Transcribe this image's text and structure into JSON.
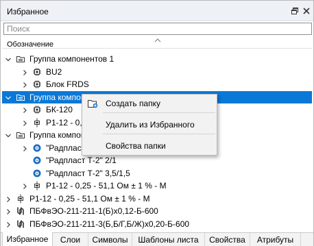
{
  "panel": {
    "title": "Избранное",
    "float_icon": "restore-window-icon",
    "close_icon": "close-icon"
  },
  "search": {
    "placeholder": "Поиск",
    "value": ""
  },
  "column": {
    "header": "Обозначение",
    "sort": "ascending"
  },
  "tree": [
    {
      "label": "Группа компонентов 1",
      "icon": "folder-icon",
      "chevron": "expanded",
      "indent": 0
    },
    {
      "label": "BU2",
      "icon": "chip-icon",
      "chevron": "collapsed",
      "indent": 1
    },
    {
      "label": "Блок FRDS",
      "icon": "chip-icon",
      "chevron": "collapsed",
      "indent": 1
    },
    {
      "label": "Группа компонентов 2",
      "icon": "folder-icon",
      "chevron": "expanded",
      "indent": 0,
      "selected": true
    },
    {
      "label": "БК-120",
      "icon": "chip-icon",
      "chevron": "collapsed",
      "indent": 1
    },
    {
      "label": "Р1-12 - 0,25 - 51,1 Ом ± 1 % - М",
      "icon": "resistor-icon",
      "chevron": "collapsed",
      "indent": 1
    },
    {
      "label": "Группа компонентов 3",
      "icon": "folder-icon",
      "chevron": "expanded",
      "indent": 0
    },
    {
      "label": "\"Радпласт Т-2\" 1/1",
      "icon": "cable-reel-icon",
      "chevron": "collapsed",
      "indent": 1
    },
    {
      "label": "\"Радпласт Т-2\" 2/1",
      "icon": "cable-reel-icon",
      "chevron": "none",
      "indent": 1
    },
    {
      "label": "\"Радпласт Т-2\" 3,5/1,5",
      "icon": "cable-reel-icon",
      "chevron": "none",
      "indent": 1
    },
    {
      "label": "Р1-12 - 0,25 - 51,1 Ом ± 1 % - М",
      "icon": "resistor-icon",
      "chevron": "collapsed",
      "indent": 1
    },
    {
      "label": "Р1-12 - 0,25 - 51,1 Ом ± 1 % - М",
      "icon": "resistor-icon",
      "chevron": "collapsed",
      "indent": 0
    },
    {
      "label": "ПБФвЭО-211-211-1(Б)х0,12-Б-600",
      "icon": "wire-icon",
      "chevron": "collapsed",
      "indent": 0
    },
    {
      "label": "ПБФвЭО-211-211-3(Б,Б/Г,Б/Ж)х0,20-Б-600",
      "icon": "wire-icon",
      "chevron": "collapsed",
      "indent": 0
    }
  ],
  "tabs": [
    {
      "label": "Избранное",
      "active": true
    },
    {
      "label": "Слои",
      "active": false
    },
    {
      "label": "Символы",
      "active": false
    },
    {
      "label": "Шаблоны листа",
      "active": false
    },
    {
      "label": "Свойства",
      "active": false
    },
    {
      "label": "Атрибуты",
      "active": false
    }
  ],
  "context_menu": {
    "items": [
      {
        "label": "Создать папку",
        "icon": "new-folder-icon"
      },
      {
        "label": "Удалить из Избранного",
        "icon": ""
      },
      {
        "label": "Свойства папки",
        "icon": ""
      }
    ]
  },
  "colors": {
    "selection": "#0a78d7",
    "titlebar": "#eef1f6",
    "menu_bg": "#f2f2f2"
  }
}
